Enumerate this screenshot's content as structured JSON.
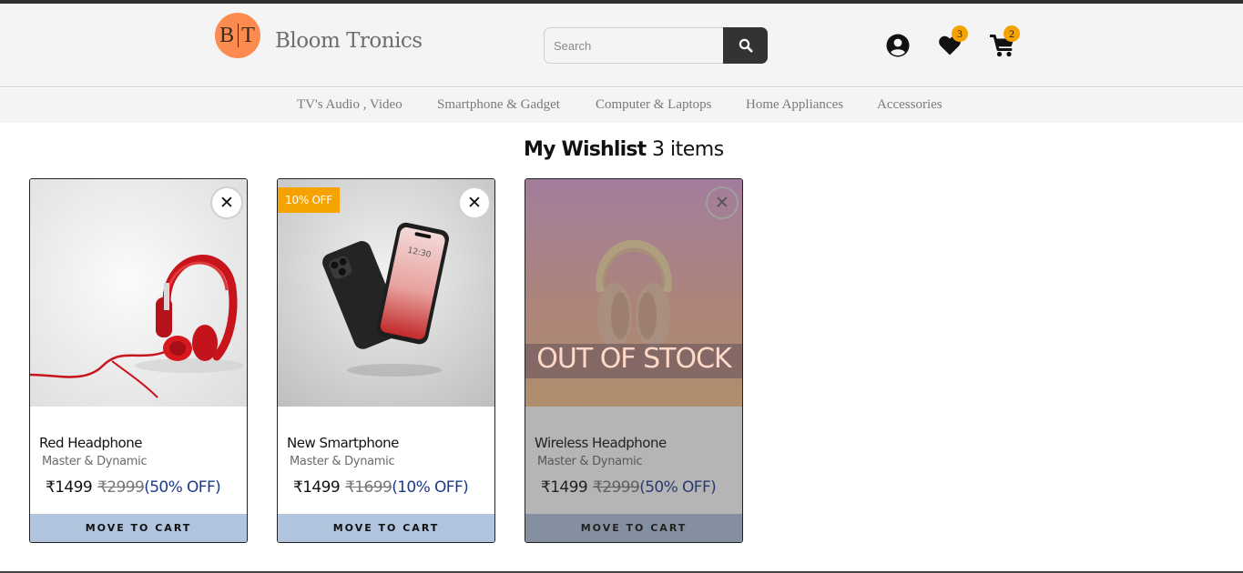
{
  "header": {
    "logo_left": "B",
    "logo_right": "T",
    "brand_name": "Bloom Tronics",
    "search_placeholder": "Search",
    "wishlist_count": "3",
    "cart_count": "2"
  },
  "nav": {
    "items": [
      "TV's Audio , Video",
      "Smartphone & Gadget",
      "Computer & Laptops",
      "Home Appliances",
      "Accessories"
    ]
  },
  "wishlist": {
    "title": "My Wishlist",
    "count_label": "3 items",
    "items": [
      {
        "name": "Red Headphone",
        "brand": "Master & Dynamic",
        "price": "₹1499",
        "mrp": "₹2999",
        "discount": "(50% OFF)",
        "tag": "",
        "button": "MOVE TO CART",
        "remove_symbol": "✕",
        "stock_label": ""
      },
      {
        "name": "New Smartphone",
        "brand": "Master & Dynamic",
        "price": "₹1499",
        "mrp": "₹1699",
        "discount": "(10% OFF)",
        "tag": "10% OFF",
        "button": "MOVE TO CART",
        "remove_symbol": "✕",
        "stock_label": "",
        "phone_time": "12:30"
      },
      {
        "name": "Wireless Headphone",
        "brand": "Master & Dynamic",
        "price": "₹1499",
        "mrp": "₹2999",
        "discount": "(50% OFF)",
        "tag": "",
        "button": "MOVE TO CART",
        "remove_symbol": "✕",
        "stock_label": "OUT OF STOCK"
      }
    ]
  },
  "colors": {
    "accent_badge": "#f5a300",
    "logo_circle": "#fb8b4f",
    "move_button": "#b0c4de",
    "discount_text": "#1d3a8a"
  },
  "icons": {
    "search": "search-icon",
    "account": "user-circle-icon",
    "wishlist": "heart-icon",
    "cart": "cart-icon",
    "remove": "close-icon"
  }
}
